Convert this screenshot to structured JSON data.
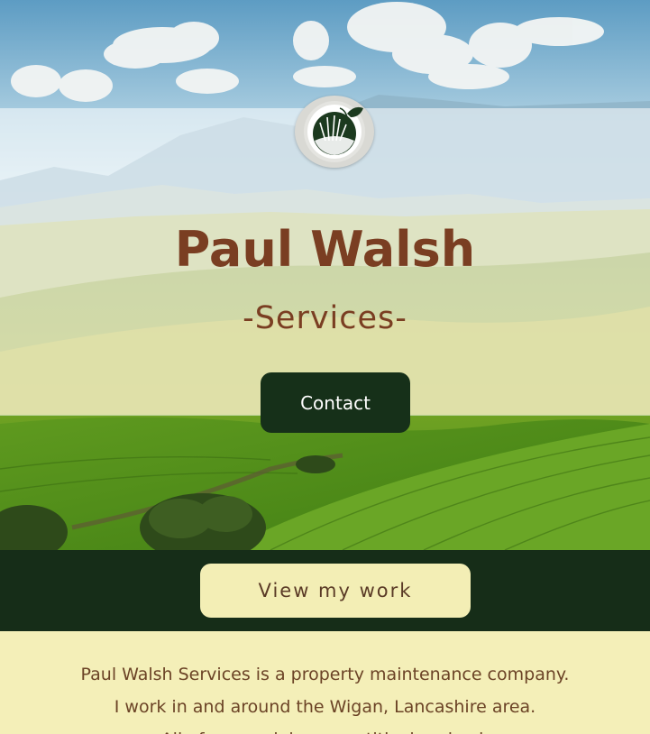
{
  "hero": {
    "title": "Paul Walsh",
    "subtitle": "-Services-",
    "contact_label": "Contact",
    "logo_icon": "grass-sprout-logo-icon"
  },
  "band": {
    "view_work_label": "View my work"
  },
  "about": {
    "line1": "Paul Walsh Services is a property maintenance company.",
    "line2": "I work in and around the Wigan, Lancashire area.",
    "line3": "All of my work is competitively priced."
  },
  "colors": {
    "brown": "#7a3e22",
    "dark_green": "#163019",
    "cream": "#f4efb8"
  }
}
